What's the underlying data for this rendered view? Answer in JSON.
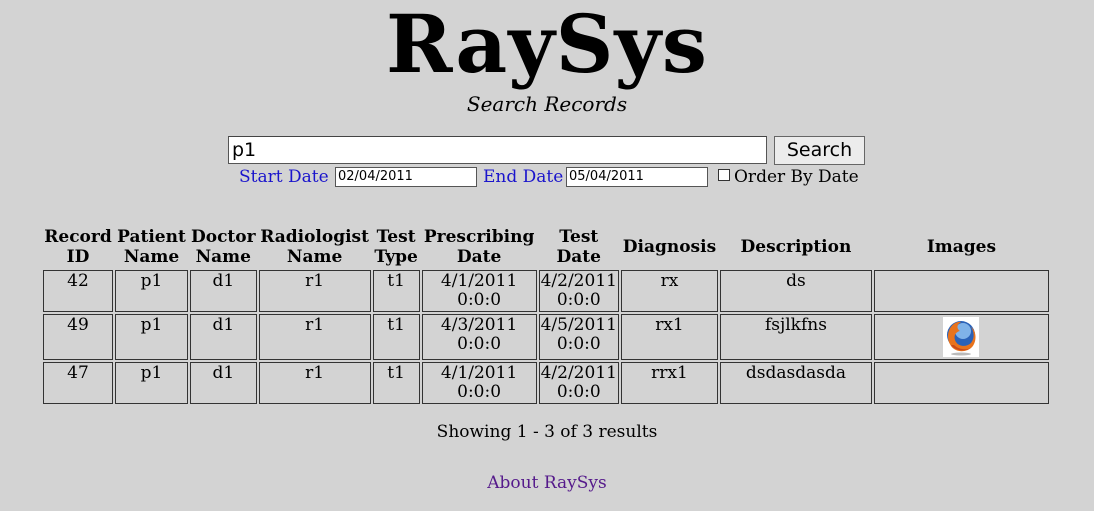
{
  "header": {
    "title": "RaySys",
    "subtitle": "Search Records"
  },
  "search": {
    "query": "p1",
    "button_label": "Search",
    "start_date_label": "Start Date",
    "start_date_value": "02/04/2011",
    "end_date_label": "End Date",
    "end_date_value": "05/04/2011",
    "order_by_date_label": "Order By Date",
    "order_by_date_checked": false
  },
  "table": {
    "headers": [
      [
        "Record",
        "ID"
      ],
      [
        "Patient",
        "Name"
      ],
      [
        "Doctor",
        "Name"
      ],
      [
        "Radiologist",
        "Name"
      ],
      [
        "Test",
        "Type"
      ],
      [
        "Prescribing",
        "Date"
      ],
      [
        "Test",
        "Date"
      ],
      [
        "Diagnosis",
        ""
      ],
      [
        "Description",
        ""
      ],
      [
        "Images",
        ""
      ]
    ],
    "rows": [
      {
        "record_id": "42",
        "patient_name": "p1",
        "doctor_name": "d1",
        "radiologist_name": "r1",
        "test_type": "t1",
        "prescribing_date": [
          "4/1/2011",
          "0:0:0"
        ],
        "test_date": [
          "4/2/2011",
          "0:0:0"
        ],
        "diagnosis": "rx",
        "description": "ds",
        "image": ""
      },
      {
        "record_id": "49",
        "patient_name": "p1",
        "doctor_name": "d1",
        "radiologist_name": "r1",
        "test_type": "t1",
        "prescribing_date": [
          "4/3/2011",
          "0:0:0"
        ],
        "test_date": [
          "4/5/2011",
          "0:0:0"
        ],
        "diagnosis": "rx1",
        "description": "fsjlkfns",
        "image": "firefox-icon"
      },
      {
        "record_id": "47",
        "patient_name": "p1",
        "doctor_name": "d1",
        "radiologist_name": "r1",
        "test_type": "t1",
        "prescribing_date": [
          "4/1/2011",
          "0:0:0"
        ],
        "test_date": [
          "4/2/2011",
          "0:0:0"
        ],
        "diagnosis": "rrx1",
        "description": "dsdasdasda",
        "image": ""
      }
    ]
  },
  "footer": {
    "showing_text": "Showing 1 - 3 of 3 results",
    "about_link": "About RaySys"
  },
  "colors": {
    "background": "#d3d3d3",
    "label_blue": "#1a14cc",
    "visited_link": "#551a8b"
  }
}
